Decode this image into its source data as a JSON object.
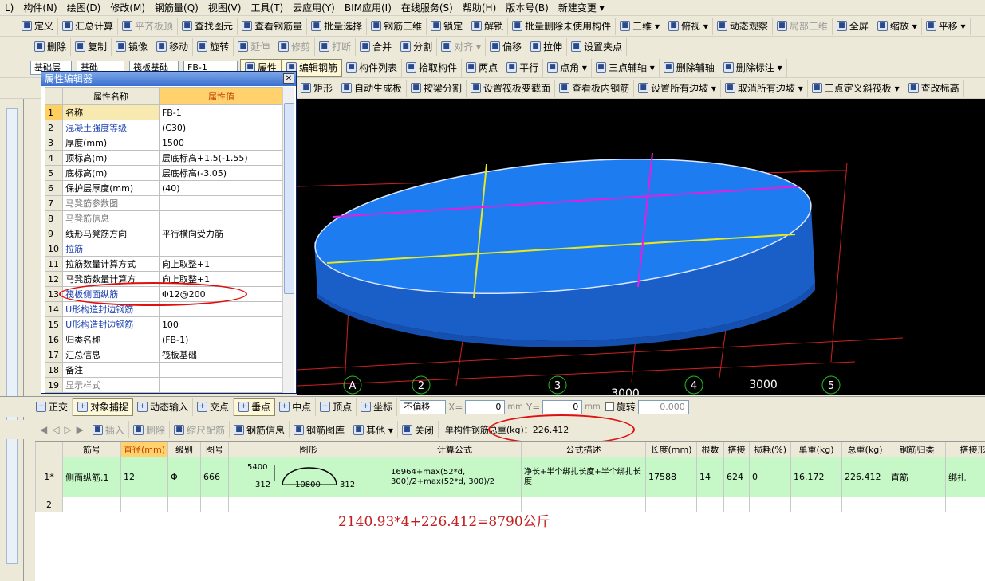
{
  "menu": [
    "L)",
    "构件(N)",
    "绘图(D)",
    "修改(M)",
    "钢筋量(Q)",
    "视图(V)",
    "工具(T)",
    "云应用(Y)",
    "BIM应用(I)",
    "在线服务(S)",
    "帮助(H)",
    "版本号(B)",
    "新建变更 ▾"
  ],
  "toolbar1": [
    "定义",
    "汇总计算",
    "平齐板顶",
    "查找图元",
    "查看钢筋量",
    "批量选择",
    "钢筋三维",
    "锁定",
    "解锁",
    "批量删除未使用构件",
    "三维 ▾",
    "俯视 ▾",
    "动态观察",
    "局部三维",
    "全屏",
    "缩放 ▾",
    "平移 ▾"
  ],
  "toolbar2": [
    "删除",
    "复制",
    "镜像",
    "移动",
    "旋转",
    "延伸",
    "修剪",
    "打断",
    "合并",
    "分割",
    "对齐 ▾",
    "偏移",
    "拉伸",
    "设置夹点"
  ],
  "toolbar3": {
    "layer": "基础层",
    "type": "基础",
    "sub": "筏板基础",
    "item": "FB-1",
    "buttons": [
      "属性",
      "编辑钢筋",
      "构件列表",
      "拾取构件",
      "两点",
      "平行",
      "点角 ▾",
      "三点辅轴 ▾",
      "删除辅轴",
      "删除标注 ▾"
    ]
  },
  "toolbar4": [
    "矩形",
    "自动生成板",
    "按梁分割",
    "设置筏板变截面",
    "查看板内钢筋",
    "设置所有边坡 ▾",
    "取消所有边坡 ▾",
    "三点定义斜筏板 ▾",
    "查改标高"
  ],
  "prop_editor": {
    "title": "属性编辑器",
    "close": "✕",
    "header": {
      "name": "属性名称",
      "value": "属性值"
    },
    "rows": [
      {
        "no": "1",
        "name": "名称",
        "value": "FB-1"
      },
      {
        "no": "2",
        "name": "混凝土强度等级",
        "value": "(C30)"
      },
      {
        "no": "3",
        "name": "厚度(mm)",
        "value": "1500"
      },
      {
        "no": "4",
        "name": "顶标高(m)",
        "value": "层底标高+1.5(-1.55)"
      },
      {
        "no": "5",
        "name": "底标高(m)",
        "value": "层底标高(-3.05)"
      },
      {
        "no": "6",
        "name": "保护层厚度(mm)",
        "value": "(40)"
      },
      {
        "no": "7",
        "name": "马凳筋参数图",
        "value": ""
      },
      {
        "no": "8",
        "name": "马凳筋信息",
        "value": ""
      },
      {
        "no": "9",
        "name": "线形马凳筋方向",
        "value": "平行横向受力筋"
      },
      {
        "no": "10",
        "name": "拉筋",
        "value": ""
      },
      {
        "no": "11",
        "name": "拉筋数量计算方式",
        "value": "向上取整+1"
      },
      {
        "no": "12",
        "name": "马凳筋数量计算方",
        "value": "向上取整+1"
      },
      {
        "no": "13",
        "name": "筏板侧面纵筋",
        "value": "Φ12@200"
      },
      {
        "no": "14",
        "name": "U形构造封边钢筋",
        "value": ""
      },
      {
        "no": "15",
        "name": "U形构造封边钢筋",
        "value": "100"
      },
      {
        "no": "16",
        "name": "归类名称",
        "value": "(FB-1)"
      },
      {
        "no": "17",
        "name": "汇总信息",
        "value": "筏板基础"
      },
      {
        "no": "18",
        "name": "备注",
        "value": ""
      },
      {
        "no": "19",
        "name": "显示样式",
        "value": ""
      }
    ]
  },
  "viewport": {
    "axis_labels": [
      "A",
      "2",
      "3",
      "4",
      "5"
    ],
    "dims": [
      "3000",
      "3000"
    ]
  },
  "snapbar": {
    "items": [
      "正交",
      "对象捕捉",
      "动态输入",
      "交点",
      "垂点",
      "中点",
      "顶点",
      "坐标"
    ],
    "offset_select": "不偏移",
    "x_label": "X=",
    "x_value": "0",
    "y_label": "Y=",
    "y_value": "0",
    "mm": "mm",
    "rotate_label": "旋转",
    "rotate_value": "0.000"
  },
  "rebar_toolbar": {
    "items": [
      "插入",
      "删除",
      "缩尺配筋",
      "钢筋信息",
      "钢筋图库",
      "其他 ▾",
      "关闭"
    ],
    "total": "单构件钢筋总重(kg)：226.412"
  },
  "rebar_table": {
    "headers": [
      "",
      "筋号",
      "直径(mm)",
      "级别",
      "图号",
      "图形",
      "计算公式",
      "公式描述",
      "长度(mm)",
      "根数",
      "搭接",
      "损耗(%)",
      "单重(kg)",
      "总重(kg)",
      "钢筋归类",
      "搭接形式"
    ],
    "rows": [
      {
        "rn": "1*",
        "name": "侧面纵筋.1",
        "dia": "12",
        "grade": "Φ",
        "fig": "666",
        "shape": {
          "h": "5400",
          "l": "312",
          "mid": "10800",
          "r": "312"
        },
        "formula": "16964+max(52*d, 300)/2+max(52*d, 300)/2",
        "desc": "净长+半个绑扎长度+半个绑扎长度",
        "len": "17588",
        "count": "14",
        "lap": "624",
        "loss": "0",
        "unit": "16.172",
        "total": "226.412",
        "cls": "直筋",
        "laptype": "绑扎"
      },
      {
        "rn": "2",
        "name": "",
        "dia": "",
        "grade": "",
        "fig": "",
        "shape": {
          "h": "",
          "l": "",
          "mid": "",
          "r": ""
        },
        "formula": "",
        "desc": "",
        "len": "",
        "count": "",
        "lap": "",
        "loss": "",
        "unit": "",
        "total": "",
        "cls": "",
        "laptype": ""
      }
    ]
  },
  "note": "2140.93*4+226.412=8790公斤"
}
